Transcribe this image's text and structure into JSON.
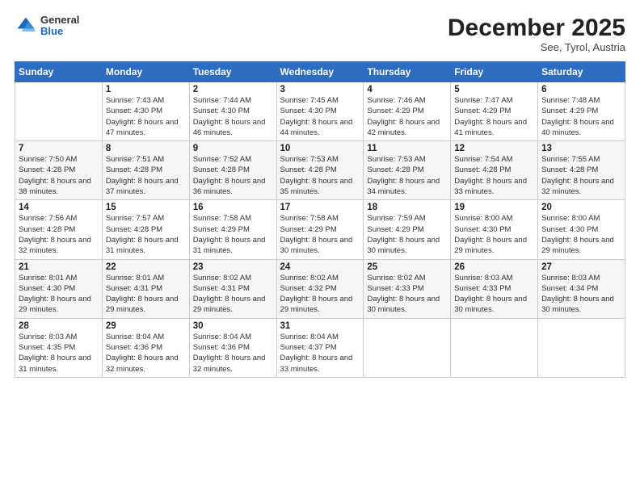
{
  "header": {
    "logo": {
      "general": "General",
      "blue": "Blue"
    },
    "month": "December 2025",
    "location": "See, Tyrol, Austria"
  },
  "weekdays": [
    "Sunday",
    "Monday",
    "Tuesday",
    "Wednesday",
    "Thursday",
    "Friday",
    "Saturday"
  ],
  "weeks": [
    [
      {
        "day": "",
        "sunrise": "",
        "sunset": "",
        "daylight": ""
      },
      {
        "day": "1",
        "sunrise": "Sunrise: 7:43 AM",
        "sunset": "Sunset: 4:30 PM",
        "daylight": "Daylight: 8 hours and 47 minutes."
      },
      {
        "day": "2",
        "sunrise": "Sunrise: 7:44 AM",
        "sunset": "Sunset: 4:30 PM",
        "daylight": "Daylight: 8 hours and 46 minutes."
      },
      {
        "day": "3",
        "sunrise": "Sunrise: 7:45 AM",
        "sunset": "Sunset: 4:30 PM",
        "daylight": "Daylight: 8 hours and 44 minutes."
      },
      {
        "day": "4",
        "sunrise": "Sunrise: 7:46 AM",
        "sunset": "Sunset: 4:29 PM",
        "daylight": "Daylight: 8 hours and 42 minutes."
      },
      {
        "day": "5",
        "sunrise": "Sunrise: 7:47 AM",
        "sunset": "Sunset: 4:29 PM",
        "daylight": "Daylight: 8 hours and 41 minutes."
      },
      {
        "day": "6",
        "sunrise": "Sunrise: 7:48 AM",
        "sunset": "Sunset: 4:29 PM",
        "daylight": "Daylight: 8 hours and 40 minutes."
      }
    ],
    [
      {
        "day": "7",
        "sunrise": "Sunrise: 7:50 AM",
        "sunset": "Sunset: 4:28 PM",
        "daylight": "Daylight: 8 hours and 38 minutes."
      },
      {
        "day": "8",
        "sunrise": "Sunrise: 7:51 AM",
        "sunset": "Sunset: 4:28 PM",
        "daylight": "Daylight: 8 hours and 37 minutes."
      },
      {
        "day": "9",
        "sunrise": "Sunrise: 7:52 AM",
        "sunset": "Sunset: 4:28 PM",
        "daylight": "Daylight: 8 hours and 36 minutes."
      },
      {
        "day": "10",
        "sunrise": "Sunrise: 7:53 AM",
        "sunset": "Sunset: 4:28 PM",
        "daylight": "Daylight: 8 hours and 35 minutes."
      },
      {
        "day": "11",
        "sunrise": "Sunrise: 7:53 AM",
        "sunset": "Sunset: 4:28 PM",
        "daylight": "Daylight: 8 hours and 34 minutes."
      },
      {
        "day": "12",
        "sunrise": "Sunrise: 7:54 AM",
        "sunset": "Sunset: 4:28 PM",
        "daylight": "Daylight: 8 hours and 33 minutes."
      },
      {
        "day": "13",
        "sunrise": "Sunrise: 7:55 AM",
        "sunset": "Sunset: 4:28 PM",
        "daylight": "Daylight: 8 hours and 32 minutes."
      }
    ],
    [
      {
        "day": "14",
        "sunrise": "Sunrise: 7:56 AM",
        "sunset": "Sunset: 4:28 PM",
        "daylight": "Daylight: 8 hours and 32 minutes."
      },
      {
        "day": "15",
        "sunrise": "Sunrise: 7:57 AM",
        "sunset": "Sunset: 4:28 PM",
        "daylight": "Daylight: 8 hours and 31 minutes."
      },
      {
        "day": "16",
        "sunrise": "Sunrise: 7:58 AM",
        "sunset": "Sunset: 4:29 PM",
        "daylight": "Daylight: 8 hours and 31 minutes."
      },
      {
        "day": "17",
        "sunrise": "Sunrise: 7:58 AM",
        "sunset": "Sunset: 4:29 PM",
        "daylight": "Daylight: 8 hours and 30 minutes."
      },
      {
        "day": "18",
        "sunrise": "Sunrise: 7:59 AM",
        "sunset": "Sunset: 4:29 PM",
        "daylight": "Daylight: 8 hours and 30 minutes."
      },
      {
        "day": "19",
        "sunrise": "Sunrise: 8:00 AM",
        "sunset": "Sunset: 4:30 PM",
        "daylight": "Daylight: 8 hours and 29 minutes."
      },
      {
        "day": "20",
        "sunrise": "Sunrise: 8:00 AM",
        "sunset": "Sunset: 4:30 PM",
        "daylight": "Daylight: 8 hours and 29 minutes."
      }
    ],
    [
      {
        "day": "21",
        "sunrise": "Sunrise: 8:01 AM",
        "sunset": "Sunset: 4:30 PM",
        "daylight": "Daylight: 8 hours and 29 minutes."
      },
      {
        "day": "22",
        "sunrise": "Sunrise: 8:01 AM",
        "sunset": "Sunset: 4:31 PM",
        "daylight": "Daylight: 8 hours and 29 minutes."
      },
      {
        "day": "23",
        "sunrise": "Sunrise: 8:02 AM",
        "sunset": "Sunset: 4:31 PM",
        "daylight": "Daylight: 8 hours and 29 minutes."
      },
      {
        "day": "24",
        "sunrise": "Sunrise: 8:02 AM",
        "sunset": "Sunset: 4:32 PM",
        "daylight": "Daylight: 8 hours and 29 minutes."
      },
      {
        "day": "25",
        "sunrise": "Sunrise: 8:02 AM",
        "sunset": "Sunset: 4:33 PM",
        "daylight": "Daylight: 8 hours and 30 minutes."
      },
      {
        "day": "26",
        "sunrise": "Sunrise: 8:03 AM",
        "sunset": "Sunset: 4:33 PM",
        "daylight": "Daylight: 8 hours and 30 minutes."
      },
      {
        "day": "27",
        "sunrise": "Sunrise: 8:03 AM",
        "sunset": "Sunset: 4:34 PM",
        "daylight": "Daylight: 8 hours and 30 minutes."
      }
    ],
    [
      {
        "day": "28",
        "sunrise": "Sunrise: 8:03 AM",
        "sunset": "Sunset: 4:35 PM",
        "daylight": "Daylight: 8 hours and 31 minutes."
      },
      {
        "day": "29",
        "sunrise": "Sunrise: 8:04 AM",
        "sunset": "Sunset: 4:36 PM",
        "daylight": "Daylight: 8 hours and 32 minutes."
      },
      {
        "day": "30",
        "sunrise": "Sunrise: 8:04 AM",
        "sunset": "Sunset: 4:36 PM",
        "daylight": "Daylight: 8 hours and 32 minutes."
      },
      {
        "day": "31",
        "sunrise": "Sunrise: 8:04 AM",
        "sunset": "Sunset: 4:37 PM",
        "daylight": "Daylight: 8 hours and 33 minutes."
      },
      {
        "day": "",
        "sunrise": "",
        "sunset": "",
        "daylight": ""
      },
      {
        "day": "",
        "sunrise": "",
        "sunset": "",
        "daylight": ""
      },
      {
        "day": "",
        "sunrise": "",
        "sunset": "",
        "daylight": ""
      }
    ]
  ]
}
